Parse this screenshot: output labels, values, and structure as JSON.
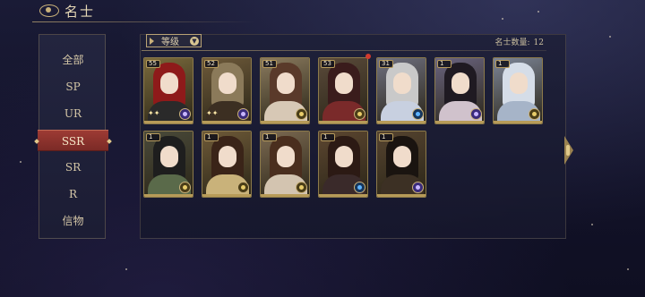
{
  "header": {
    "title": "名士"
  },
  "sidebar": {
    "items": [
      {
        "label": "全部",
        "active": false
      },
      {
        "label": "SP",
        "active": false
      },
      {
        "label": "UR",
        "active": false
      },
      {
        "label": "SSR",
        "active": true
      },
      {
        "label": "SR",
        "active": false
      },
      {
        "label": "R",
        "active": false
      },
      {
        "label": "信物",
        "active": false
      }
    ]
  },
  "toolbar": {
    "sort_label": "等级",
    "count_label": "名士数量:",
    "count_value": "12"
  },
  "cards": [
    {
      "level": "55",
      "hair": "#8e1a1a",
      "robe": "#2a2a2a",
      "bg": "#7a6a3c",
      "element": "purple",
      "sparkle": true
    },
    {
      "level": "52",
      "hair": "#8b7a5a",
      "robe": "#3c2f22",
      "bg": "#6e5a3a",
      "element": "purple",
      "sparkle": true
    },
    {
      "level": "51",
      "hair": "#5a3a2a",
      "robe": "#d7c8b5",
      "bg": "#8a7a5e",
      "element": "yellow",
      "sparkle": false
    },
    {
      "level": "53",
      "hair": "#3a1c1c",
      "robe": "#7a2a2a",
      "bg": "#5a4a3a",
      "element": "yellow",
      "sparkle": false,
      "new": true
    },
    {
      "level": "31",
      "hair": "#c9c9c9",
      "robe": "#c8d0e0",
      "bg": "#6f7080",
      "element": "blue",
      "sparkle": false
    },
    {
      "level": "1",
      "hair": "#1f1a22",
      "robe": "#d0c2cc",
      "bg": "#6a6480",
      "element": "purple",
      "sparkle": false
    },
    {
      "level": "1",
      "hair": "#d5dde8",
      "robe": "#a6b4c8",
      "bg": "#7c8597",
      "element": "yellow",
      "sparkle": false
    },
    {
      "level": "1",
      "hair": "#1e1e1e",
      "robe": "#5a6a4a",
      "bg": "#4a4a3a",
      "element": "yellow",
      "sparkle": false
    },
    {
      "level": "1",
      "hair": "#3a2418",
      "robe": "#c9b27a",
      "bg": "#6e5a38",
      "element": "yellow",
      "sparkle": false
    },
    {
      "level": "1",
      "hair": "#4a2e1e",
      "robe": "#d3c4b0",
      "bg": "#7c6a52",
      "element": "yellow",
      "sparkle": false
    },
    {
      "level": "1",
      "hair": "#2c1a14",
      "robe": "#3a2a2a",
      "bg": "#5c4630",
      "element": "blue",
      "sparkle": false
    },
    {
      "level": "1",
      "hair": "#1a1410",
      "robe": "#3c3024",
      "bg": "#564430",
      "element": "purple",
      "sparkle": false
    }
  ]
}
